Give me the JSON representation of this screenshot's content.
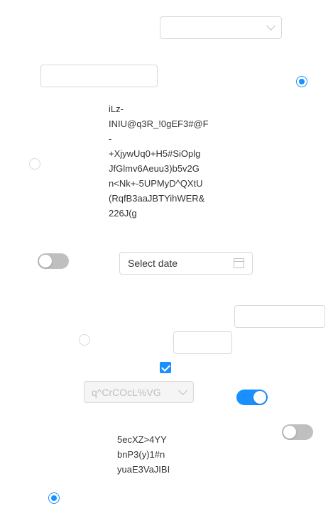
{
  "form": {
    "select_top": {
      "value": ""
    },
    "text_input_1": {
      "value": ""
    },
    "radio_1": {
      "checked": true
    },
    "text_block_1": "iLz-\nINIU@q3R_!0gEF3#@F\n-\n+XjywUq0+H5#SiOplg\nJfGlmv6Aeuu3)b5v2G\nn<Nk+-5UPMyD^QXtU\n(RqfB3aaJBTYihWER&\n226J(g",
    "radio_2": {
      "checked": false
    },
    "toggle_1": {
      "on": false
    },
    "datepicker": {
      "placeholder": "Select date"
    },
    "text_input_2": {
      "value": ""
    },
    "radio_3": {
      "checked": false
    },
    "text_input_3": {
      "value": ""
    },
    "checkbox_1": {
      "checked": true
    },
    "select_disabled": {
      "value": "q^CrCOcL%VG"
    },
    "toggle_2": {
      "on": true
    },
    "toggle_3": {
      "on": false
    },
    "text_block_2": "5ecXZ>4YY\nbnP3(y)1#n\nyuaE3VaJIBI",
    "radio_4": {
      "checked": true
    }
  },
  "colors": {
    "accent": "#1890ff",
    "border": "#d9d9d9",
    "toggle_off": "#bfbfbf",
    "disabled_bg": "#f5f5f5"
  },
  "icons": [
    "chevron-down-icon",
    "calendar-icon",
    "checkmark-icon"
  ]
}
